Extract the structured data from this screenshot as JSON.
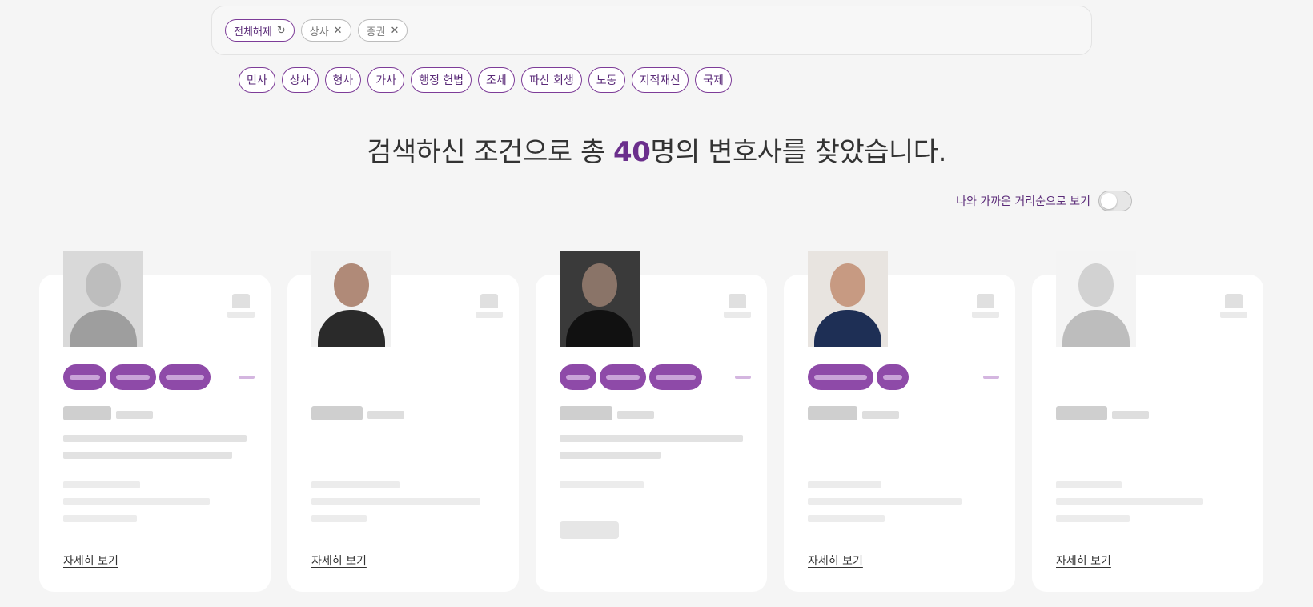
{
  "filters": {
    "reset_label": "전체해제",
    "selected": [
      {
        "label": "상사"
      },
      {
        "label": "증권"
      }
    ]
  },
  "categories": [
    "민사",
    "상사",
    "형사",
    "가사",
    "행정 헌법",
    "조세",
    "파산 회생",
    "노동",
    "지적재산",
    "국제"
  ],
  "result": {
    "prefix": "검색하신 조건으로 총 ",
    "count": "40",
    "suffix": "명의 변호사를 찾았습니다."
  },
  "sort": {
    "label": "나와 가까운 거리순으로 보기",
    "enabled": false
  },
  "cards": [
    {
      "detail_label": "자세히 보기"
    },
    {
      "detail_label": "자세히 보기"
    },
    {
      "detail_label": ""
    },
    {
      "detail_label": "자세히 보기"
    },
    {
      "detail_label": "자세히 보기"
    }
  ],
  "colors": {
    "accent": "#6b2f8c",
    "tag_fill": "#8e4aa8",
    "background": "#f5f5f5"
  }
}
